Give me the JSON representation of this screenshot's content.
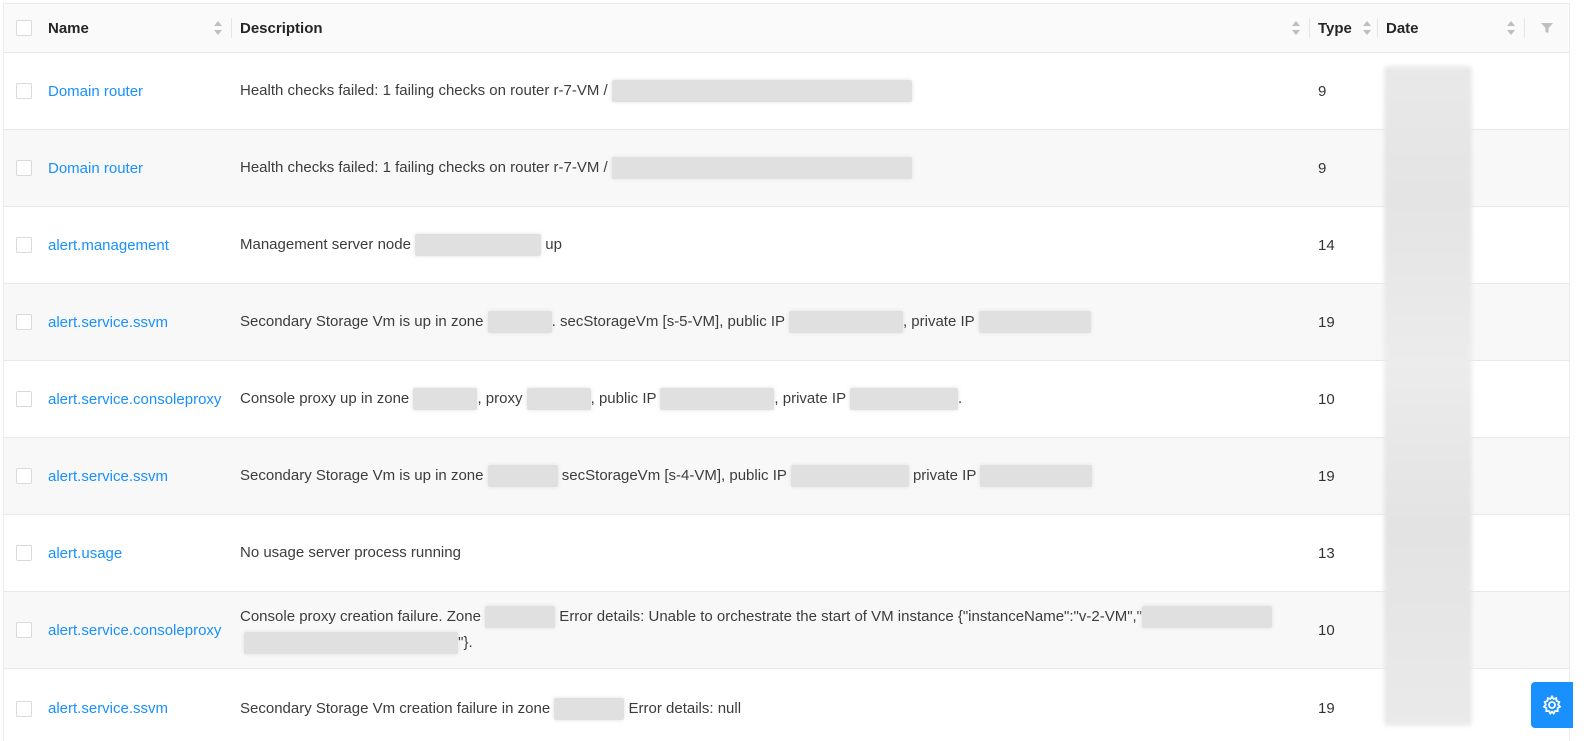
{
  "columns": {
    "name": "Name",
    "description": "Description",
    "type": "Type",
    "date": "Date"
  },
  "rows": [
    {
      "name": "Domain router",
      "type": "9",
      "desc": [
        {
          "t": "Health checks failed: 1 failing checks on router r-7-VM / "
        },
        {
          "r": 300
        }
      ]
    },
    {
      "name": "Domain router",
      "type": "9",
      "desc": [
        {
          "t": "Health checks failed: 1 failing checks on router r-7-VM / "
        },
        {
          "r": 300
        }
      ]
    },
    {
      "name": "alert.management",
      "type": "14",
      "desc": [
        {
          "t": "Management server node "
        },
        {
          "r": 126
        },
        {
          "t": " up"
        }
      ]
    },
    {
      "name": "alert.service.ssvm",
      "type": "19",
      "desc": [
        {
          "t": "Secondary Storage Vm is up in zone "
        },
        {
          "r": 64
        },
        {
          "t": ". secStorageVm [s-5-VM], public IP "
        },
        {
          "r": 114
        },
        {
          "t": ", private IP "
        },
        {
          "r": 112
        }
      ]
    },
    {
      "name": "alert.service.consoleproxy",
      "type": "10",
      "desc": [
        {
          "t": "Console proxy up in zone "
        },
        {
          "r": 64
        },
        {
          "t": ", proxy "
        },
        {
          "r": 64
        },
        {
          "t": ", public IP "
        },
        {
          "r": 114
        },
        {
          "t": ", private IP "
        },
        {
          "r": 108
        },
        {
          "t": "."
        }
      ]
    },
    {
      "name": "alert.service.ssvm",
      "type": "19",
      "desc": [
        {
          "t": "Secondary Storage Vm is up in zone "
        },
        {
          "r": 70
        },
        {
          "t": " secStorageVm [s-4-VM], public IP "
        },
        {
          "r": 118
        },
        {
          "t": " private IP "
        },
        {
          "r": 112
        }
      ]
    },
    {
      "name": "alert.usage",
      "type": "13",
      "desc": [
        {
          "t": "No usage server process running"
        }
      ]
    },
    {
      "name": "alert.service.consoleproxy",
      "type": "10",
      "desc": [
        {
          "t": "Console proxy creation failure. Zone "
        },
        {
          "r": 70
        },
        {
          "t": " Error details: Unable to orchestrate the start of VM instance {\"instanceName\":\"v-2-VM\",\""
        },
        {
          "r": 130
        },
        {
          "t": " "
        },
        {
          "r": 214
        },
        {
          "t": "\"}."
        }
      ]
    },
    {
      "name": "alert.service.ssvm",
      "type": "19",
      "desc": [
        {
          "t": "Secondary Storage Vm creation failure in zone "
        },
        {
          "r": 70
        },
        {
          "t": " Error details: null"
        }
      ]
    }
  ],
  "icons": {
    "sort": "sort-icon",
    "filter": "filter-icon",
    "settings": "gear-icon"
  },
  "colors": {
    "link": "#1890ff",
    "settings_button": "#1890ff"
  }
}
